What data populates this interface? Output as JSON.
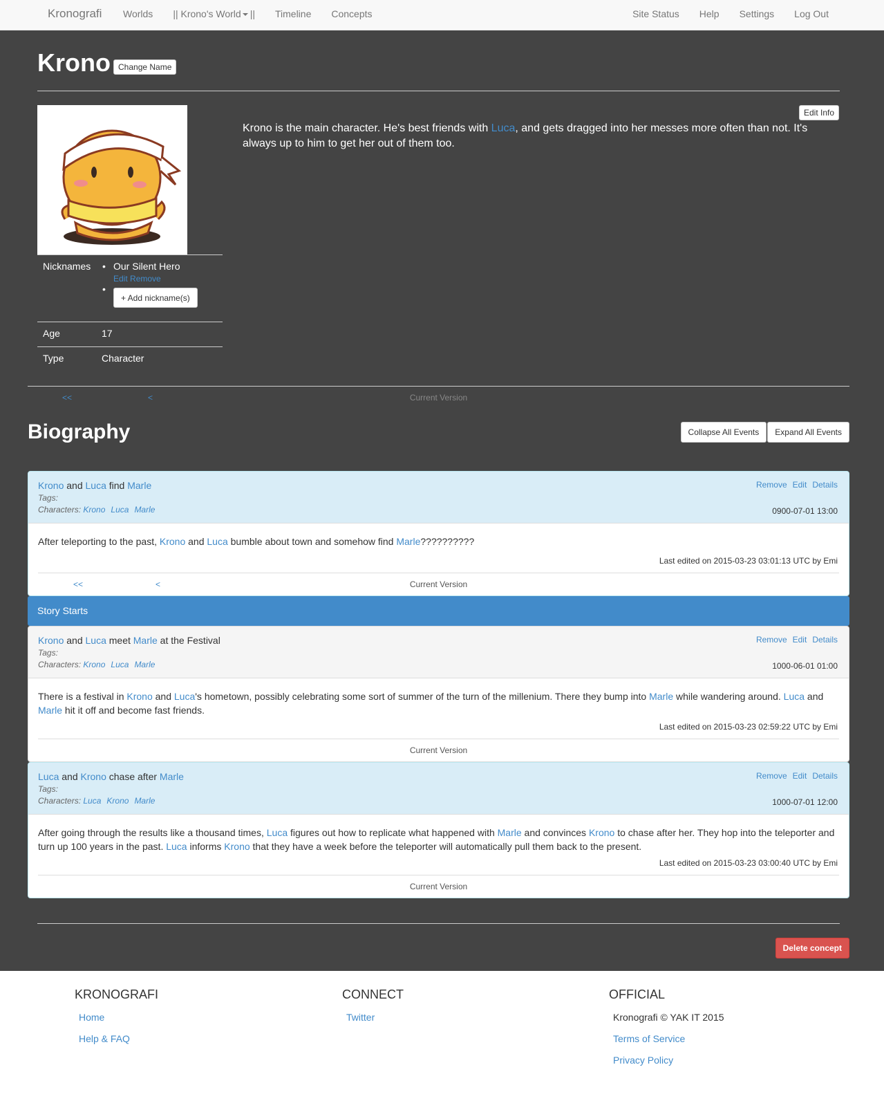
{
  "navbar": {
    "brand": "Kronografi",
    "left": [
      "Worlds",
      "|| Krono's World",
      "||",
      "Timeline",
      "Concepts"
    ],
    "right": [
      "Site Status",
      "Help",
      "Settings",
      "Log Out"
    ]
  },
  "concept": {
    "name": "Krono",
    "change_name_label": "Change Name",
    "edit_info_label": "Edit Info",
    "description": {
      "pre": "Krono is the main character. He's best friends with ",
      "link": "Luca",
      "post": ", and gets dragged into her messes more often than not. It's always up to him to get her out of them too."
    },
    "info": {
      "nicknames_label": "Nicknames",
      "nicknames": [
        "Our Silent Hero"
      ],
      "nick_edit": "Edit",
      "nick_remove": "Remove",
      "add_nickname_label": "+ Add nickname(s)",
      "age_label": "Age",
      "age": "17",
      "type_label": "Type",
      "type": "Character"
    }
  },
  "version_nav": {
    "first": "<<",
    "prev": "<",
    "current": "Current Version"
  },
  "biography": {
    "title": "Biography",
    "collapse_label": "Collapse All Events",
    "expand_label": "Expand All Events"
  },
  "events": [
    {
      "title_parts": [
        "Krono",
        " and ",
        "Luca",
        " find ",
        "Marle"
      ],
      "tags_label": "Tags:",
      "characters_label": "Characters:",
      "characters": [
        "Krono",
        "Luca",
        "Marle"
      ],
      "actions": [
        "Remove",
        "Edit",
        "Details"
      ],
      "date": "0900-07-01 13:00",
      "body_parts": [
        "After teleporting to the past, ",
        "Krono",
        " and ",
        "Luca",
        " bumble about town and somehow find ",
        "Marle",
        "??????????"
      ],
      "edited": "Last edited on 2015-03-23 03:01:13 UTC by Emi",
      "nav": {
        "first": "<<",
        "prev": "<",
        "current": "Current Version"
      }
    },
    {
      "title_parts": [
        "Krono",
        " and ",
        "Luca",
        " meet ",
        "Marle",
        " at the Festival"
      ],
      "tags_label": "Tags:",
      "characters_label": "Characters:",
      "characters": [
        "Krono",
        "Luca",
        "Marle"
      ],
      "actions": [
        "Remove",
        "Edit",
        "Details"
      ],
      "date": "1000-06-01 01:00",
      "body_parts": [
        "There is a festival in ",
        "Krono",
        " and ",
        "Luca",
        "'s hometown, possibly celebrating some sort of summer of the turn of the millenium. There they bump into ",
        "Marle",
        " while wandering around. ",
        "Luca",
        " and ",
        "Marle",
        " hit it off and become fast friends."
      ],
      "edited": "Last edited on 2015-03-23 02:59:22 UTC by Emi",
      "nav": {
        "current": "Current Version"
      }
    },
    {
      "title_parts": [
        "Luca",
        " and ",
        "Krono",
        " chase after ",
        "Marle"
      ],
      "tags_label": "Tags:",
      "characters_label": "Characters:",
      "characters": [
        "Luca",
        "Krono",
        "Marle"
      ],
      "actions": [
        "Remove",
        "Edit",
        "Details"
      ],
      "date": "1000-07-01 12:00",
      "body_parts": [
        "After going through the results like a thousand times, ",
        "Luca",
        " figures out how to replicate what happened with ",
        "Marle",
        " and convinces ",
        "Krono",
        " to chase after her. They hop into the teleporter and turn up 100 years in the past. ",
        "Luca",
        " informs ",
        "Krono",
        " that they have a week before the teleporter will automatically pull them back to the present."
      ],
      "edited": "Last edited on 2015-03-23 03:00:40 UTC by Emi",
      "nav": {
        "current": "Current Version"
      }
    }
  ],
  "marker": "Story Starts",
  "delete_label": "Delete concept",
  "footer": {
    "col1": {
      "heading": "KRONOGRAFI",
      "links": [
        "Home",
        "Help & FAQ"
      ]
    },
    "col2": {
      "heading": "CONNECT",
      "links": [
        "Twitter"
      ]
    },
    "col3": {
      "heading": "OFFICIAL",
      "copyright": "Kronografi © YAK IT 2015",
      "links": [
        "Terms of Service",
        "Privacy Policy"
      ]
    }
  }
}
